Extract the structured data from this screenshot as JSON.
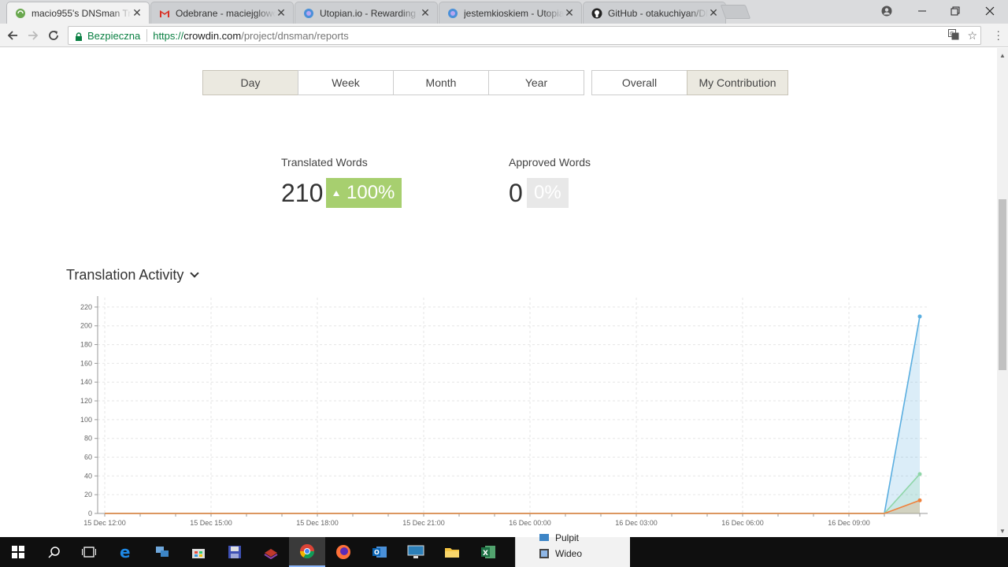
{
  "browser": {
    "tabs": [
      {
        "title": "macio955's DNSman Tra",
        "favicon": "crowdin-icon",
        "active": true
      },
      {
        "title": "Odebrane - maciejglowc",
        "favicon": "gmail-icon",
        "active": false
      },
      {
        "title": "Utopian.io - Rewarding C",
        "favicon": "utopian-icon",
        "active": false
      },
      {
        "title": "jestemkioskiem - Utopia",
        "favicon": "utopian-icon",
        "active": false
      },
      {
        "title": "GitHub - otakuchiyan/DN",
        "favicon": "github-icon",
        "active": false
      }
    ],
    "secure_label": "Bezpieczna",
    "url_protocol": "https://",
    "url_host": "crowdin.com",
    "url_path": "/project/dnsman/reports"
  },
  "period_tabs": [
    {
      "label": "Day",
      "selected": true
    },
    {
      "label": "Week",
      "selected": false
    },
    {
      "label": "Month",
      "selected": false
    },
    {
      "label": "Year",
      "selected": false
    }
  ],
  "scope_tabs": [
    {
      "label": "Overall",
      "selected": false
    },
    {
      "label": "My Contribution",
      "selected": true
    }
  ],
  "stats": {
    "translated": {
      "label": "Translated Words",
      "value": "210",
      "change": "100%"
    },
    "approved": {
      "label": "Approved Words",
      "value": "0",
      "change": "0%"
    }
  },
  "section": {
    "title": "Translation Activity"
  },
  "chart_data": {
    "type": "area",
    "title": "",
    "xlabel": "",
    "ylabel": "",
    "ylim": [
      0,
      230
    ],
    "yticks": [
      0,
      20,
      40,
      60,
      80,
      100,
      120,
      140,
      160,
      180,
      200,
      220
    ],
    "x_tick_labels": [
      "15 Dec 12:00",
      "15 Dec 15:00",
      "15 Dec 18:00",
      "15 Dec 21:00",
      "16 Dec 00:00",
      "16 Dec 03:00",
      "16 Dec 06:00",
      "16 Dec 09:00"
    ],
    "x_range_hours": [
      0,
      23
    ],
    "grid": true,
    "series": [
      {
        "color": "#5aaee0",
        "points": [
          [
            0,
            0
          ],
          [
            22,
            0
          ],
          [
            23,
            210
          ]
        ]
      },
      {
        "color": "#8fd6a8",
        "points": [
          [
            0,
            0
          ],
          [
            22,
            0
          ],
          [
            23,
            42
          ]
        ]
      },
      {
        "color": "#f0823c",
        "points": [
          [
            0,
            0
          ],
          [
            22,
            0
          ],
          [
            23,
            14
          ]
        ]
      }
    ]
  },
  "taskbar": {
    "apps": [
      "start-icon",
      "search-icon",
      "task-view-icon",
      "edge-icon",
      "network-icon",
      "store-icon",
      "save-icon",
      "books-icon",
      "chrome-icon",
      "firefox-icon",
      "outlook-icon",
      "desktop-icon",
      "explorer-icon",
      "excel-icon"
    ],
    "popup_items": [
      "Pulpit",
      "Wideo"
    ]
  }
}
